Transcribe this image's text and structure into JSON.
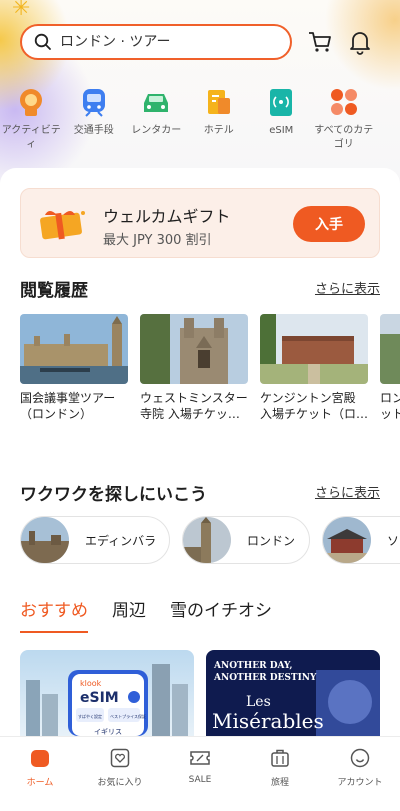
{
  "search": {
    "placeholder": "ロンドン · ツアー"
  },
  "quick_links": [
    {
      "label": "アクティビティ",
      "icon": "activity-icon"
    },
    {
      "label": "交通手段",
      "icon": "train-icon"
    },
    {
      "label": "レンタカー",
      "icon": "car-icon"
    },
    {
      "label": "ホテル",
      "icon": "hotel-icon"
    },
    {
      "label": "eSIM",
      "icon": "esim-icon"
    },
    {
      "label": "すべてのカテゴリ",
      "icon": "all-categories-icon"
    }
  ],
  "welcome": {
    "title": "ウェルカムギフト",
    "subtitle": "最大 JPY 300 割引",
    "button": "入手"
  },
  "history": {
    "title": "閲覧履歴",
    "more": "さらに表示",
    "items": [
      {
        "title": "国会議事堂ツアー（ロンドン）"
      },
      {
        "title": "ウェストミンスター寺院 入場チケッ…"
      },
      {
        "title": "ケンジントン宮殿 入場チケット（ロ…"
      },
      {
        "title": "ロンドン塔入場チケット"
      }
    ]
  },
  "explore": {
    "title": "ワクワクを探しにいこう",
    "more": "さらに表示",
    "destinations": [
      {
        "name": "エディンバラ"
      },
      {
        "name": "ロンドン"
      },
      {
        "name": "ソウル"
      }
    ]
  },
  "tabs": [
    {
      "label": "おすすめ",
      "active": true
    },
    {
      "label": "周辺",
      "active": false
    },
    {
      "label": "雪のイチオシ",
      "active": false
    }
  ],
  "promos": {
    "esim": {
      "brand": "klook",
      "title": "eSIM",
      "badge1": "すばやく設定",
      "badge2": "ベストプライス保証",
      "country": "イギリス"
    },
    "miserables": {
      "line1": "ANOTHER DAY,",
      "line2": "ANOTHER DESTINY",
      "title_les": "Les",
      "title_main": "Misérables"
    }
  },
  "nav": [
    {
      "label": "ホーム",
      "icon": "home-icon",
      "active": true
    },
    {
      "label": "お気に入り",
      "icon": "heart-icon",
      "active": false
    },
    {
      "label": "SALE",
      "icon": "sale-icon",
      "active": false
    },
    {
      "label": "旅程",
      "icon": "suitcase-icon",
      "active": false
    },
    {
      "label": "アカウント",
      "icon": "account-icon",
      "active": false
    }
  ],
  "colors": {
    "accent": "#ef5a22"
  }
}
